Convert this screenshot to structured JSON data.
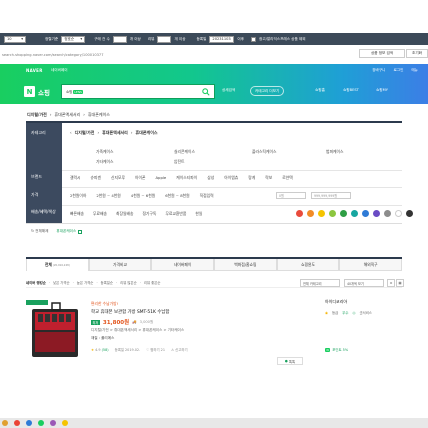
{
  "toolbar": {
    "count": "10",
    "sort_label": "정렬기준",
    "sort_value": "정호순",
    "purchase_label": "구매 건 수",
    "purchase_suffix": "개 이상",
    "review_label": "리뷰",
    "review_suffix": "개 이상",
    "reg_label": "등록일",
    "reg_value": "20231103",
    "reg_suffix": "이후",
    "ad_exclude_label": "광고/알리익스프레스 상품 제외",
    "btn_save": "상품 정보 검색",
    "btn_reset": "초기화"
  },
  "url": "search.shopping.naver.com/search/category/100010377",
  "gnb": {
    "naver": "NAVER",
    "service_link": "네이버페이",
    "right_links": [
      "장바구니",
      "로그인",
      "메뉴"
    ],
    "logo_text": "쇼핑",
    "search_badge": "쇼핑",
    "search_badge_tag": "LENS",
    "menu_items": [
      "쇼핑홈",
      "쇼핑BEST",
      "쇼핑MY"
    ],
    "category_label": "카테고리 더보기",
    "detail_label": "상세검색"
  },
  "breadcrumb": [
    "디지털/가전",
    "휴대폰액세서리",
    "휴대폰케이스"
  ],
  "filter": {
    "side_labels": [
      "카테고리",
      "브랜드",
      "가격",
      "배송/혜택/색상"
    ],
    "path": [
      "디지털/가전",
      "휴대폰액세서리",
      "휴대폰케이스"
    ],
    "categories": [
      "가죽케이스",
      "실리콘케이스",
      "플라스틱케이스",
      "범퍼케이스",
      "기타케이스",
      "압전트"
    ],
    "brands": [
      "갤럭시",
      "슈피겐",
      "신지모루",
      "아이폰",
      "Apple",
      "케이스티파이",
      "삼성",
      "아이엠츄",
      "랑게",
      "락보",
      "로얀택"
    ],
    "prices": [
      "2천원이하",
      "2천원 ~ 4천원",
      "4천원 ~ 6천원",
      "6천원 ~ 8천원",
      "직접입력"
    ],
    "price_min_placeholder": "0원",
    "price_max_placeholder": "999,999,999원",
    "benefits": [
      "빠른배송",
      "무료배송",
      "최장일배송",
      "정기구독",
      "무료교환반품",
      "한일"
    ],
    "colors": [
      "#e94b3c",
      "#f28c28",
      "#f5c400",
      "#8cc63f",
      "#2e9e44",
      "#17a6a0",
      "#2f7bd6",
      "#6a4bc4",
      "#8c8c8c",
      "#ffffff",
      "#333333"
    ],
    "reset_label": "전체해제",
    "applied_tag": "휴대폰케이스"
  },
  "tabs": [
    {
      "label": "전체",
      "count": "(20,916,248)"
    },
    {
      "label": "가격비교",
      "count": ""
    },
    {
      "label": "네이버페이",
      "count": ""
    },
    {
      "label": "백화점/홈쇼핑",
      "count": ""
    },
    {
      "label": "쇼핑윈도",
      "count": ""
    },
    {
      "label": "해외직구",
      "count": ""
    }
  ],
  "sort": {
    "items": [
      "네이버 랭킹순",
      "낮은 가격순",
      "높은 가격순",
      "등록일순",
      "리뷰 많은순",
      "리뷰 좋은순"
    ],
    "view_select": "40개씩 보기",
    "layout_select": "전체 카테고리"
  },
  "product": {
    "promo": "편리한 수납가방!",
    "title": "학교 휴대폰 보관함 가방 SMT-51K 수납함",
    "low_badge": "최저",
    "price": "31,800원",
    "price_note": "3,000원",
    "category_path": "디지털/가전 > 휴대폰액세서리 > 휴대폰케이스 > 기타케이스",
    "spec": "재질 : 폴리에스",
    "rating": "4.9",
    "reviews": "(58)",
    "reg_date": "등록일 2019.02.",
    "wish": "찜하기 21",
    "report": "신고하기",
    "talk": "톡톡"
  },
  "seller": {
    "name": "아이디코리아",
    "grade_label": "등급",
    "grade_value": "우수",
    "service_label": "굿서비스",
    "npay_label": "포인트 5%"
  }
}
